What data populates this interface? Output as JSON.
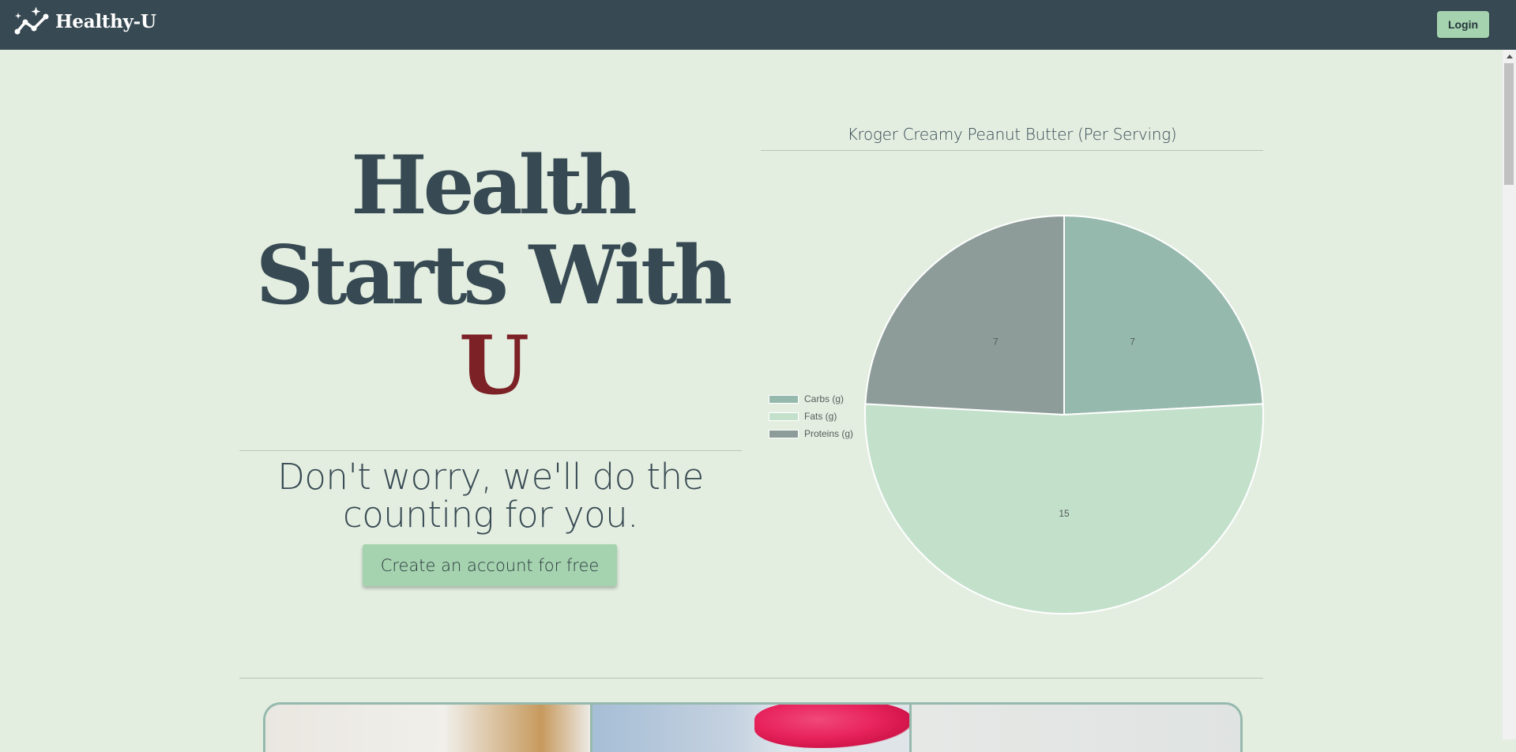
{
  "nav": {
    "brand_name": "Healthy-U",
    "brand_icon": "sparkle-trend-icon",
    "login_label": "Login"
  },
  "hero": {
    "title_line1": "Health",
    "title_line2": "Starts With",
    "title_accent": "U",
    "tagline": "Don't worry, we'll do the counting for you.",
    "cta_label": "Create an account for free"
  },
  "colors": {
    "nav_bg": "#374952",
    "page_bg": "#e3eee1",
    "accent_red": "#7c2125",
    "button_green": "#a6d3af",
    "text_dark": "#374952"
  },
  "chart_data": {
    "type": "pie",
    "title": "Kroger Creamy Peanut Butter (Per Serving)",
    "categories": [
      "Carbs (g)",
      "Fats (g)",
      "Proteins (g)"
    ],
    "values": [
      7,
      15,
      7
    ],
    "colors": [
      "#96b9ad",
      "#c3e0cb",
      "#8d9c98"
    ],
    "legend_position": "left"
  }
}
